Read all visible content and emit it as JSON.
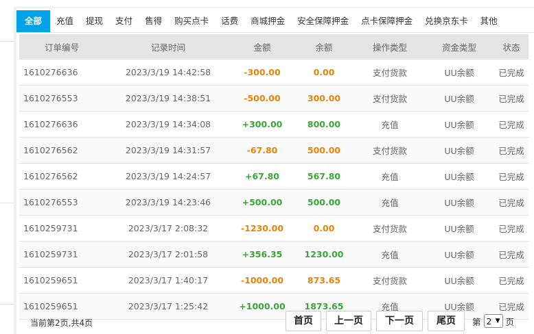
{
  "tabs": [
    "全部",
    "充值",
    "提现",
    "支付",
    "售得",
    "购买点卡",
    "话费",
    "商城押金",
    "安全保障押金",
    "点卡保障押金",
    "兑换京东卡",
    "其他"
  ],
  "table": {
    "headers": [
      "订单编号",
      "记录时间",
      "金额",
      "余额",
      "操作类型",
      "资金类型",
      "状态"
    ],
    "rows": [
      {
        "order": "1610276636",
        "time": "2023/3/19 14:42:58",
        "amount": "-300.00",
        "balance": "0.00",
        "op": "支付货款",
        "fund": "UU余额",
        "status": "已完成"
      },
      {
        "order": "1610276553",
        "time": "2023/3/19 14:38:51",
        "amount": "-500.00",
        "balance": "300.00",
        "op": "支付货款",
        "fund": "UU余额",
        "status": "已完成"
      },
      {
        "order": "1610276636",
        "time": "2023/3/19 14:34:08",
        "amount": "+300.00",
        "balance": "800.00",
        "op": "充值",
        "fund": "UU余额",
        "status": "已完成"
      },
      {
        "order": "1610276562",
        "time": "2023/3/19 14:31:57",
        "amount": "-67.80",
        "balance": "500.00",
        "op": "支付货款",
        "fund": "UU余额",
        "status": "已完成"
      },
      {
        "order": "1610276562",
        "time": "2023/3/19 14:24:57",
        "amount": "+67.80",
        "balance": "567.80",
        "op": "充值",
        "fund": "UU余额",
        "status": "已完成"
      },
      {
        "order": "1610276553",
        "time": "2023/3/19 14:23:46",
        "amount": "+500.00",
        "balance": "500.00",
        "op": "充值",
        "fund": "UU余额",
        "status": "已完成"
      },
      {
        "order": "1610259731",
        "time": "2023/3/17 2:08:32",
        "amount": "-1230.00",
        "balance": "0.00",
        "op": "支付货款",
        "fund": "UU余额",
        "status": "已完成"
      },
      {
        "order": "1610259731",
        "time": "2023/3/17 2:01:58",
        "amount": "+356.35",
        "balance": "1230.00",
        "op": "充值",
        "fund": "UU余额",
        "status": "已完成"
      },
      {
        "order": "1610259651",
        "time": "2023/3/17 1:40:17",
        "amount": "-1000.00",
        "balance": "873.65",
        "op": "支付货款",
        "fund": "UU余额",
        "status": "已完成"
      },
      {
        "order": "1610259651",
        "time": "2023/3/17 1:25:42",
        "amount": "+1000.00",
        "balance": "1873.65",
        "op": "充值",
        "fund": "UU余额",
        "status": "已完成"
      }
    ]
  },
  "pagination": {
    "info": "当前第2页,共4页",
    "first": "首页",
    "prev": "上一页",
    "next": "下一页",
    "last": "尾页",
    "page_prefix": "第",
    "page_value": "2",
    "page_suffix": "页"
  },
  "colors": {
    "accent": "#00a2e8",
    "negative": "#e8840a",
    "positive": "#3aa637"
  },
  "icons": {
    "page_select": "chevron-down-icon"
  }
}
